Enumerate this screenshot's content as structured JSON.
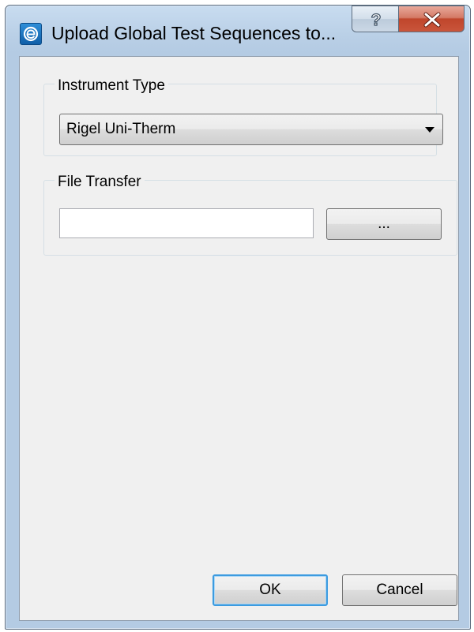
{
  "window": {
    "title": "Upload Global Test Sequences to...",
    "app_icon": "app-e-icon",
    "help_icon": "help-question-icon",
    "close_icon": "close-x-icon"
  },
  "instrument_type": {
    "label": "Instrument Type",
    "selected_value": "Rigel Uni-Therm"
  },
  "file_transfer": {
    "label": "File Transfer",
    "value": "",
    "browse_label": "..."
  },
  "buttons": {
    "ok_label": "OK",
    "cancel_label": "Cancel"
  },
  "colors": {
    "close_button": "#c9553b",
    "focus_border": "#3c9be0",
    "frame": "#b9cfe6"
  }
}
